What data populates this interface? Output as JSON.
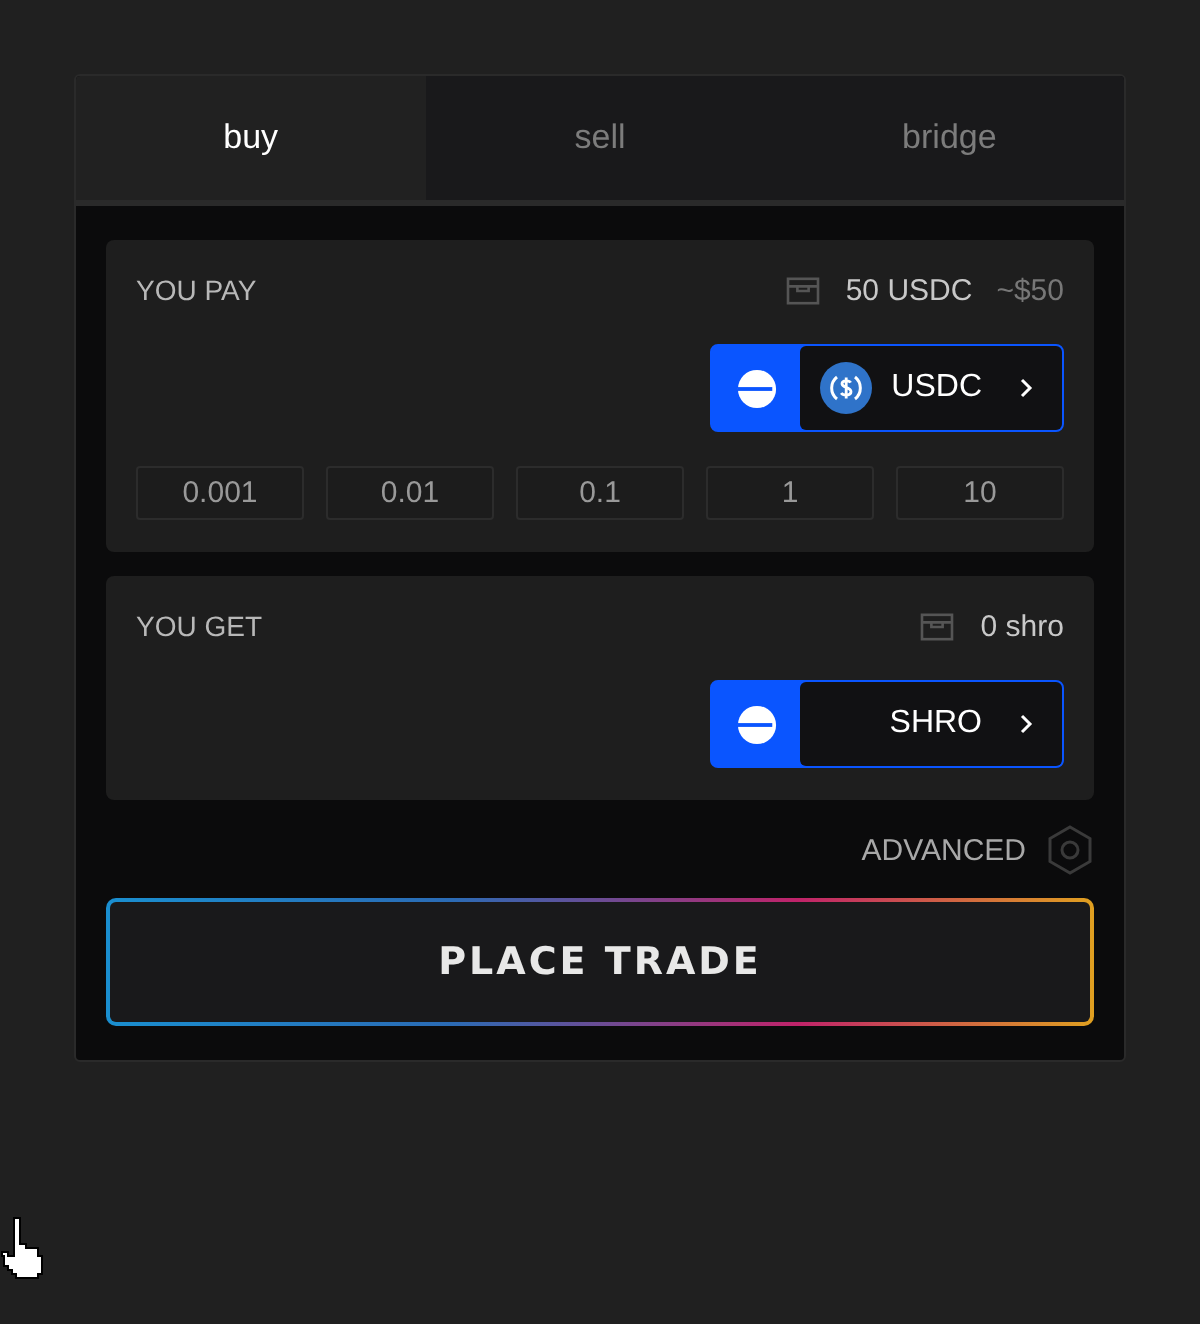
{
  "tabs": [
    {
      "label": "buy",
      "selected": true
    },
    {
      "label": "sell",
      "selected": false
    },
    {
      "label": "bridge",
      "selected": false
    }
  ],
  "sections": [
    {
      "label": "YOU PAY",
      "balance": "50 USDC",
      "usd_value": "~$50",
      "token": {
        "symbol": "USDC",
        "logo": true
      },
      "presets": [
        "0.001",
        "0.01",
        "0.1",
        "1",
        "10"
      ]
    },
    {
      "label": "YOU GET",
      "balance": "0 shro",
      "token": {
        "symbol": "SHRO",
        "logo": false
      }
    }
  ],
  "advanced": {
    "label": "ADVANCED"
  },
  "action_button": "PLACE TRADE"
}
